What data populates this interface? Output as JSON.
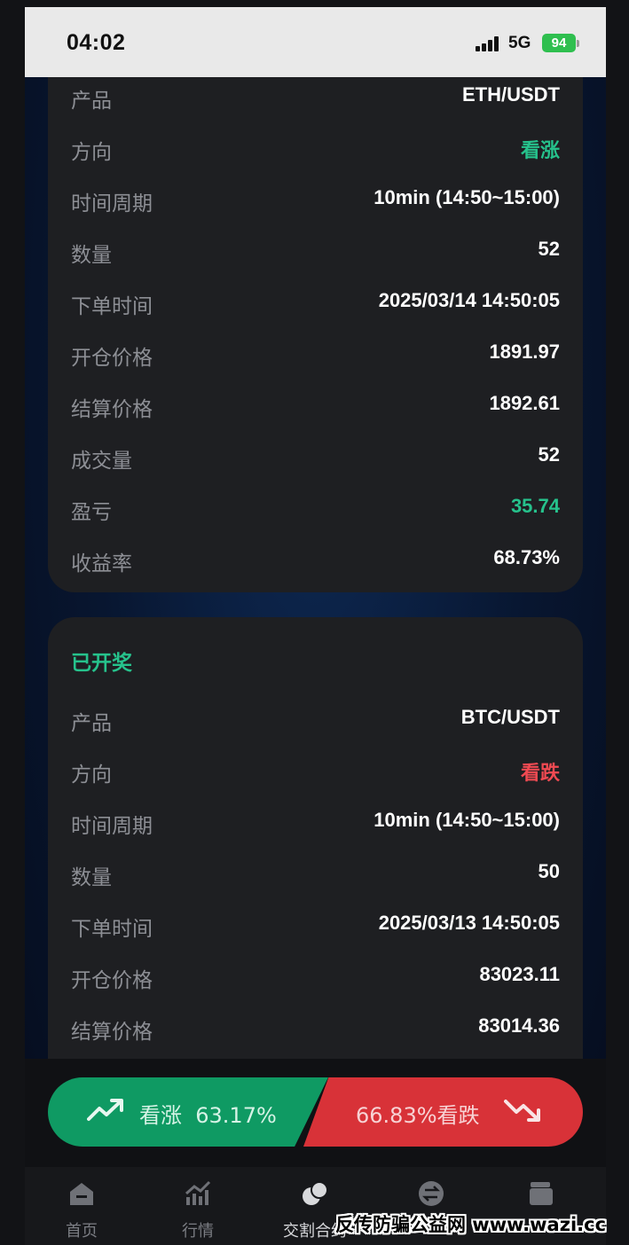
{
  "status_bar": {
    "time": "04:02",
    "network": "5G",
    "battery": "94"
  },
  "orders": [
    {
      "title": "",
      "rows": [
        {
          "label": "产品",
          "value": "ETH/USDT"
        },
        {
          "label": "方向",
          "value": "看涨"
        },
        {
          "label": "时间周期",
          "value": "10min (14:50~15:00)"
        },
        {
          "label": "数量",
          "value": "52"
        },
        {
          "label": "下单时间",
          "value": "2025/03/14 14:50:05"
        },
        {
          "label": "开仓价格",
          "value": "1891.97"
        },
        {
          "label": "结算价格",
          "value": "1892.61"
        },
        {
          "label": "成交量",
          "value": "52"
        },
        {
          "label": "盈亏",
          "value": "35.74"
        },
        {
          "label": "收益率",
          "value": "68.73%"
        }
      ]
    },
    {
      "title": "已开奖",
      "rows": [
        {
          "label": "产品",
          "value": "BTC/USDT"
        },
        {
          "label": "方向",
          "value": "看跌"
        },
        {
          "label": "时间周期",
          "value": "10min (14:50~15:00)"
        },
        {
          "label": "数量",
          "value": "50"
        },
        {
          "label": "下单时间",
          "value": "2025/03/13 14:50:05"
        },
        {
          "label": "开仓价格",
          "value": "83023.11"
        },
        {
          "label": "结算价格",
          "value": "83014.36"
        }
      ]
    }
  ],
  "trade": {
    "up_label": "看涨",
    "up_pct": "63.17%",
    "down_label": "66.83%看跌"
  },
  "tabs": [
    {
      "label": "首页",
      "icon": "home-icon"
    },
    {
      "label": "行情",
      "icon": "chart-icon"
    },
    {
      "label": "交割合约",
      "icon": "coins-icon"
    },
    {
      "label": "",
      "icon": "exchange-icon"
    },
    {
      "label": "",
      "icon": "wallet-icon"
    }
  ],
  "watermark": "反传防骗公益网 www.wazi.cc",
  "colors": {
    "green": "#26c28c",
    "red": "#f04a52",
    "card": "#1e1f22",
    "up_button": "#0f9a63",
    "down_button": "#d83238"
  }
}
